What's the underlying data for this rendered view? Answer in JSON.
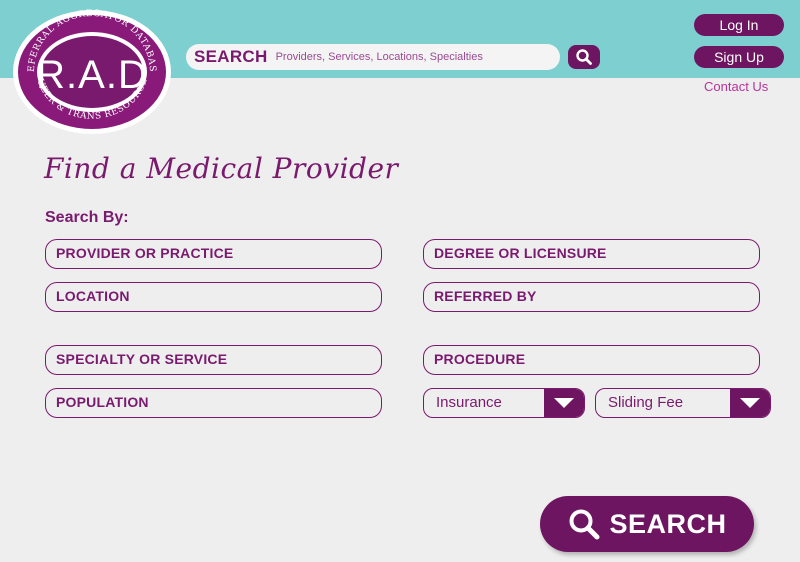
{
  "header": {
    "logo_text": "R.A.D",
    "logo_top_arc": "Referral Aggregator Database",
    "logo_bottom_arc": "Queer & Trans Resources",
    "search_label": "SEARCH",
    "search_placeholder": "Providers, Services, Locations, Specialties",
    "login_label": "Log In",
    "signup_label": "Sign Up",
    "contact_label": "Contact Us"
  },
  "main": {
    "title": "Find a Medical Provider",
    "search_by_label": "Search By:",
    "fields": {
      "provider": "PROVIDER OR PRACTICE",
      "degree": "DEGREE OR LICENSURE",
      "location": "LOCATION",
      "referred": "REFERRED BY",
      "specialty": "SPECIALTY OR SERVICE",
      "procedure": "PROCEDURE",
      "population": "POPULATION"
    },
    "insurance_select": "Insurance",
    "sliding_fee_select": "Sliding Fee",
    "search_button_label": "SEARCH"
  },
  "colors": {
    "header_bg": "#7ed0d0",
    "brand_purple": "#6d1560",
    "text_purple": "#7a1a6e",
    "contact_pink": "#b7339a",
    "page_bg": "#eeeeee"
  },
  "icons": [
    "search-icon",
    "chevron-down-icon"
  ]
}
